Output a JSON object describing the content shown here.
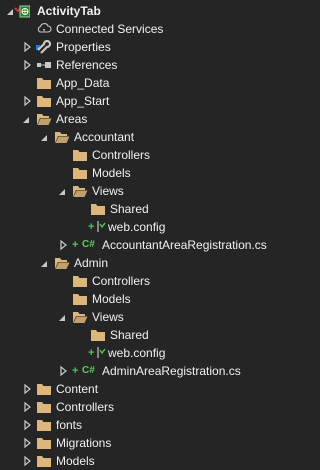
{
  "colors": {
    "background": "#252526",
    "text": "#f1f1f1",
    "folder": "#dcb67a",
    "caret": "#c8c8c8",
    "add_glyph": "#4ec94e",
    "csharp": "#5ccc5c",
    "project_check": "#d33",
    "wrench": "#c8c8c8"
  },
  "tree": {
    "project": {
      "label": "ActivityTab",
      "icon": "csharp-project-icon",
      "expanded": true
    },
    "items": [
      {
        "label": "Connected Services",
        "icon": "connected-services-icon",
        "expanded": null
      },
      {
        "label": "Properties",
        "icon": "wrench-icon",
        "expanded": false
      },
      {
        "label": "References",
        "icon": "references-icon",
        "expanded": false
      },
      {
        "label": "App_Data",
        "icon": "folder-icon",
        "expanded": null
      },
      {
        "label": "App_Start",
        "icon": "folder-icon",
        "expanded": false
      },
      {
        "label": "Areas",
        "icon": "folder-open-icon",
        "expanded": true
      },
      {
        "label": "Accountant",
        "icon": "folder-open-icon",
        "expanded": true
      },
      {
        "label": "Controllers",
        "icon": "folder-icon",
        "expanded": null
      },
      {
        "label": "Models",
        "icon": "folder-icon",
        "expanded": null
      },
      {
        "label": "Views",
        "icon": "folder-open-icon",
        "expanded": true
      },
      {
        "label": "Shared",
        "icon": "folder-icon",
        "expanded": null
      },
      {
        "label": "web.config",
        "icon": "web-config-icon",
        "expanded": null,
        "added": true
      },
      {
        "label": "AccountantAreaRegistration.cs",
        "icon": "csharp-file-icon",
        "expanded": false,
        "added": true
      },
      {
        "label": "Admin",
        "icon": "folder-open-icon",
        "expanded": true
      },
      {
        "label": "Controllers",
        "icon": "folder-icon",
        "expanded": null
      },
      {
        "label": "Models",
        "icon": "folder-icon",
        "expanded": null
      },
      {
        "label": "Views",
        "icon": "folder-open-icon",
        "expanded": true
      },
      {
        "label": "Shared",
        "icon": "folder-icon",
        "expanded": null
      },
      {
        "label": "web.config",
        "icon": "web-config-icon",
        "expanded": null,
        "added": true
      },
      {
        "label": "AdminAreaRegistration.cs",
        "icon": "csharp-file-icon",
        "expanded": false,
        "added": true
      },
      {
        "label": "Content",
        "icon": "folder-icon",
        "expanded": false
      },
      {
        "label": "Controllers",
        "icon": "folder-icon",
        "expanded": false
      },
      {
        "label": "fonts",
        "icon": "folder-icon",
        "expanded": false
      },
      {
        "label": "Migrations",
        "icon": "folder-icon",
        "expanded": false
      },
      {
        "label": "Models",
        "icon": "folder-icon",
        "expanded": false
      }
    ]
  }
}
